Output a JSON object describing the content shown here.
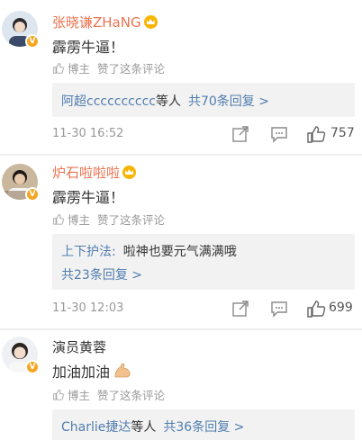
{
  "comments": [
    {
      "name": "张晓谦ZHaNG",
      "text": "霹雳牛逼！",
      "author_like": {
        "label": "博主",
        "sep": "赞了这条评论"
      },
      "reply_summary": {
        "users": "阿超cccccccccc",
        "suffix": "等人",
        "count_text": "共70条回复 >"
      },
      "time": "11-30 16:52",
      "likes": "757",
      "crown": true
    },
    {
      "name": "炉石啦啦啦",
      "text": "霹雳牛逼！",
      "author_like": {
        "label": "博主",
        "sep": "赞了这条评论"
      },
      "reply_preview": {
        "user": "上下护法:",
        "text": "啦神也要元气满满哦"
      },
      "reply_count_text": "共23条回复 >",
      "time": "11-30 12:03",
      "likes": "699",
      "crown": true
    },
    {
      "name": "演员黄蓉",
      "text": "加油加油",
      "author_like": {
        "label": "博主",
        "sep": "赞了这条评论"
      },
      "reply_summary": {
        "users": "Charlie捷达",
        "suffix": "等人",
        "count_text": "共36条回复 >"
      },
      "crown": false,
      "emoji": "flexed-biceps"
    }
  ],
  "icons": {
    "share": "share-icon",
    "comment": "comment-icon",
    "like": "thumbs-up-icon",
    "verified": "verified-badge-icon",
    "crown": "crown-icon"
  },
  "colors": {
    "name_highlight": "#eb7350",
    "link_blue": "#507daf",
    "reply_bg": "#f2f2f2",
    "verified": "#f5a623"
  }
}
